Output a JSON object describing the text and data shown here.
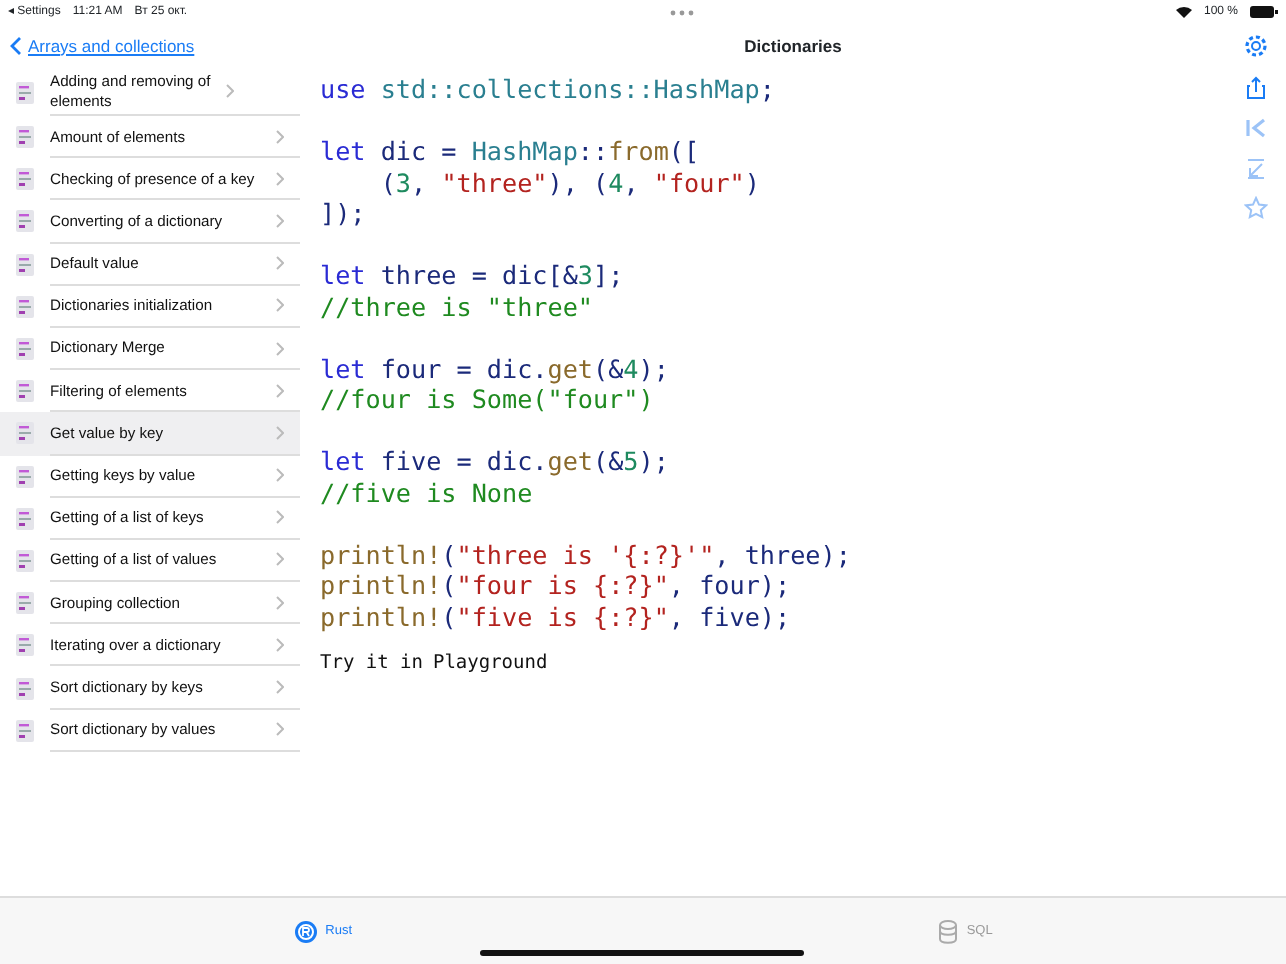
{
  "status_bar": {
    "back_app": "◂ Settings",
    "time": "11:21 AM",
    "date": "Вт 25 окт.",
    "battery": "100 %"
  },
  "sidebar": {
    "back_label": "Arrays and collections",
    "items": [
      {
        "label": "Adding and removing of elements",
        "selected": false
      },
      {
        "label": "Amount of elements",
        "selected": false
      },
      {
        "label": "Checking of presence of a key",
        "selected": false
      },
      {
        "label": "Converting of a dictionary",
        "selected": false
      },
      {
        "label": "Default value",
        "selected": false
      },
      {
        "label": "Dictionaries initialization",
        "selected": false
      },
      {
        "label": "Dictionary Merge",
        "selected": false
      },
      {
        "label": "Filtering of elements",
        "selected": false
      },
      {
        "label": "Get value by key",
        "selected": true
      },
      {
        "label": "Getting keys by value",
        "selected": false
      },
      {
        "label": "Getting of a list of keys",
        "selected": false
      },
      {
        "label": "Getting of a list of values",
        "selected": false
      },
      {
        "label": "Grouping collection",
        "selected": false
      },
      {
        "label": "Iterating over a dictionary",
        "selected": false
      },
      {
        "label": "Sort dictionary by keys",
        "selected": false
      },
      {
        "label": "Sort dictionary by values",
        "selected": false
      }
    ]
  },
  "detail": {
    "title": "Dictionaries",
    "code_blocks": [
      [
        [
          {
            "text": "use",
            "kind": "keyword"
          },
          {
            "text": " std::collections::HashMap",
            "kind": "type"
          },
          {
            "text": ";",
            "kind": "plain"
          }
        ]
      ],
      [
        [
          {
            "text": "let",
            "kind": "keyword"
          },
          {
            "text": " dic = ",
            "kind": "plain"
          },
          {
            "text": "HashMap",
            "kind": "type"
          },
          {
            "text": "::",
            "kind": "plain"
          },
          {
            "text": "from",
            "kind": "func"
          },
          {
            "text": "([",
            "kind": "plain"
          }
        ],
        [
          {
            "text": "    (",
            "kind": "plain"
          },
          {
            "text": "3",
            "kind": "number"
          },
          {
            "text": ", ",
            "kind": "plain"
          },
          {
            "text": "\"three\"",
            "kind": "string"
          },
          {
            "text": "), (",
            "kind": "plain"
          },
          {
            "text": "4",
            "kind": "number"
          },
          {
            "text": ", ",
            "kind": "plain"
          },
          {
            "text": "\"four\"",
            "kind": "string"
          },
          {
            "text": ")",
            "kind": "plain"
          }
        ],
        [
          {
            "text": "]);",
            "kind": "plain"
          }
        ]
      ],
      [
        [
          {
            "text": "let",
            "kind": "keyword"
          },
          {
            "text": " three = dic[&",
            "kind": "plain"
          },
          {
            "text": "3",
            "kind": "number"
          },
          {
            "text": "];",
            "kind": "plain"
          }
        ],
        [
          {
            "text": "//three is \"three\"",
            "kind": "comment"
          }
        ]
      ],
      [
        [
          {
            "text": "let",
            "kind": "keyword"
          },
          {
            "text": " four = dic.",
            "kind": "plain"
          },
          {
            "text": "get",
            "kind": "func"
          },
          {
            "text": "(&",
            "kind": "plain"
          },
          {
            "text": "4",
            "kind": "number"
          },
          {
            "text": ");",
            "kind": "plain"
          }
        ],
        [
          {
            "text": "//four is Some(\"four\")",
            "kind": "comment"
          }
        ]
      ],
      [
        [
          {
            "text": "let",
            "kind": "keyword"
          },
          {
            "text": " five = dic.",
            "kind": "plain"
          },
          {
            "text": "get",
            "kind": "func"
          },
          {
            "text": "(&",
            "kind": "plain"
          },
          {
            "text": "5",
            "kind": "number"
          },
          {
            "text": ");",
            "kind": "plain"
          }
        ],
        [
          {
            "text": "//five is None",
            "kind": "comment"
          }
        ]
      ],
      [
        [
          {
            "text": "println!",
            "kind": "func"
          },
          {
            "text": "(",
            "kind": "plain"
          },
          {
            "text": "\"three is '{:?}'\"",
            "kind": "string"
          },
          {
            "text": ", three);",
            "kind": "plain"
          }
        ],
        [
          {
            "text": "println!",
            "kind": "func"
          },
          {
            "text": "(",
            "kind": "plain"
          },
          {
            "text": "\"four is {:?}\"",
            "kind": "string"
          },
          {
            "text": ", four);",
            "kind": "plain"
          }
        ],
        [
          {
            "text": "println!",
            "kind": "func"
          },
          {
            "text": "(",
            "kind": "plain"
          },
          {
            "text": "\"five is {:?}\"",
            "kind": "string"
          },
          {
            "text": ", five);",
            "kind": "plain"
          }
        ]
      ]
    ],
    "try_text": "Try it in",
    "try_link": "Playground"
  },
  "tabs": [
    {
      "label": "Rust",
      "kind": "rust",
      "selected": true
    },
    {
      "label": "SQL",
      "kind": "sql",
      "selected": false
    }
  ]
}
